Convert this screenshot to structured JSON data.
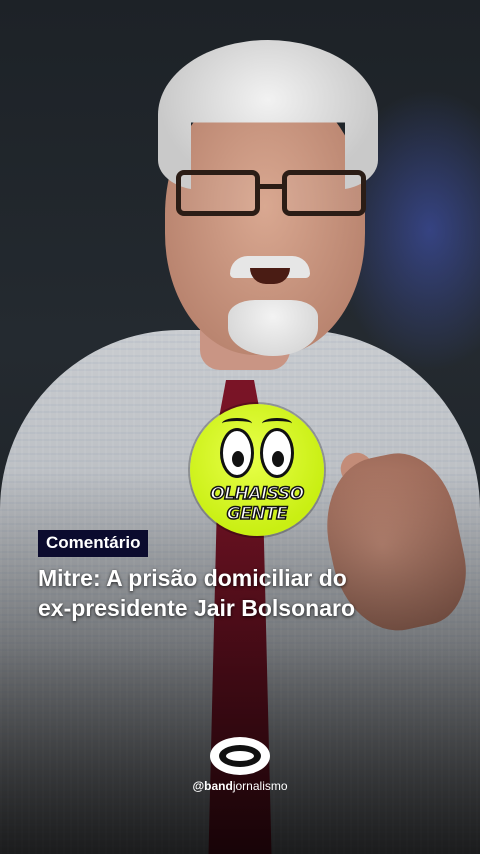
{
  "caption": {
    "tag": "Comentário",
    "headline_line1": "Mitre: A prisão domiciliar do",
    "headline_line2": "ex-presidente Jair Bolsonaro"
  },
  "sticker": {
    "line1": "OLHAISSO",
    "line2": "GENTE",
    "icon": "cartoon-eyes-icon"
  },
  "branding": {
    "handle_bold": "@band",
    "handle_rest": "jornalismo",
    "logo_icon": "band-logo-icon"
  },
  "colors": {
    "tag_bg": "#0b0b2e",
    "sticker_bg": "#c9ef13",
    "text": "#ffffff"
  }
}
